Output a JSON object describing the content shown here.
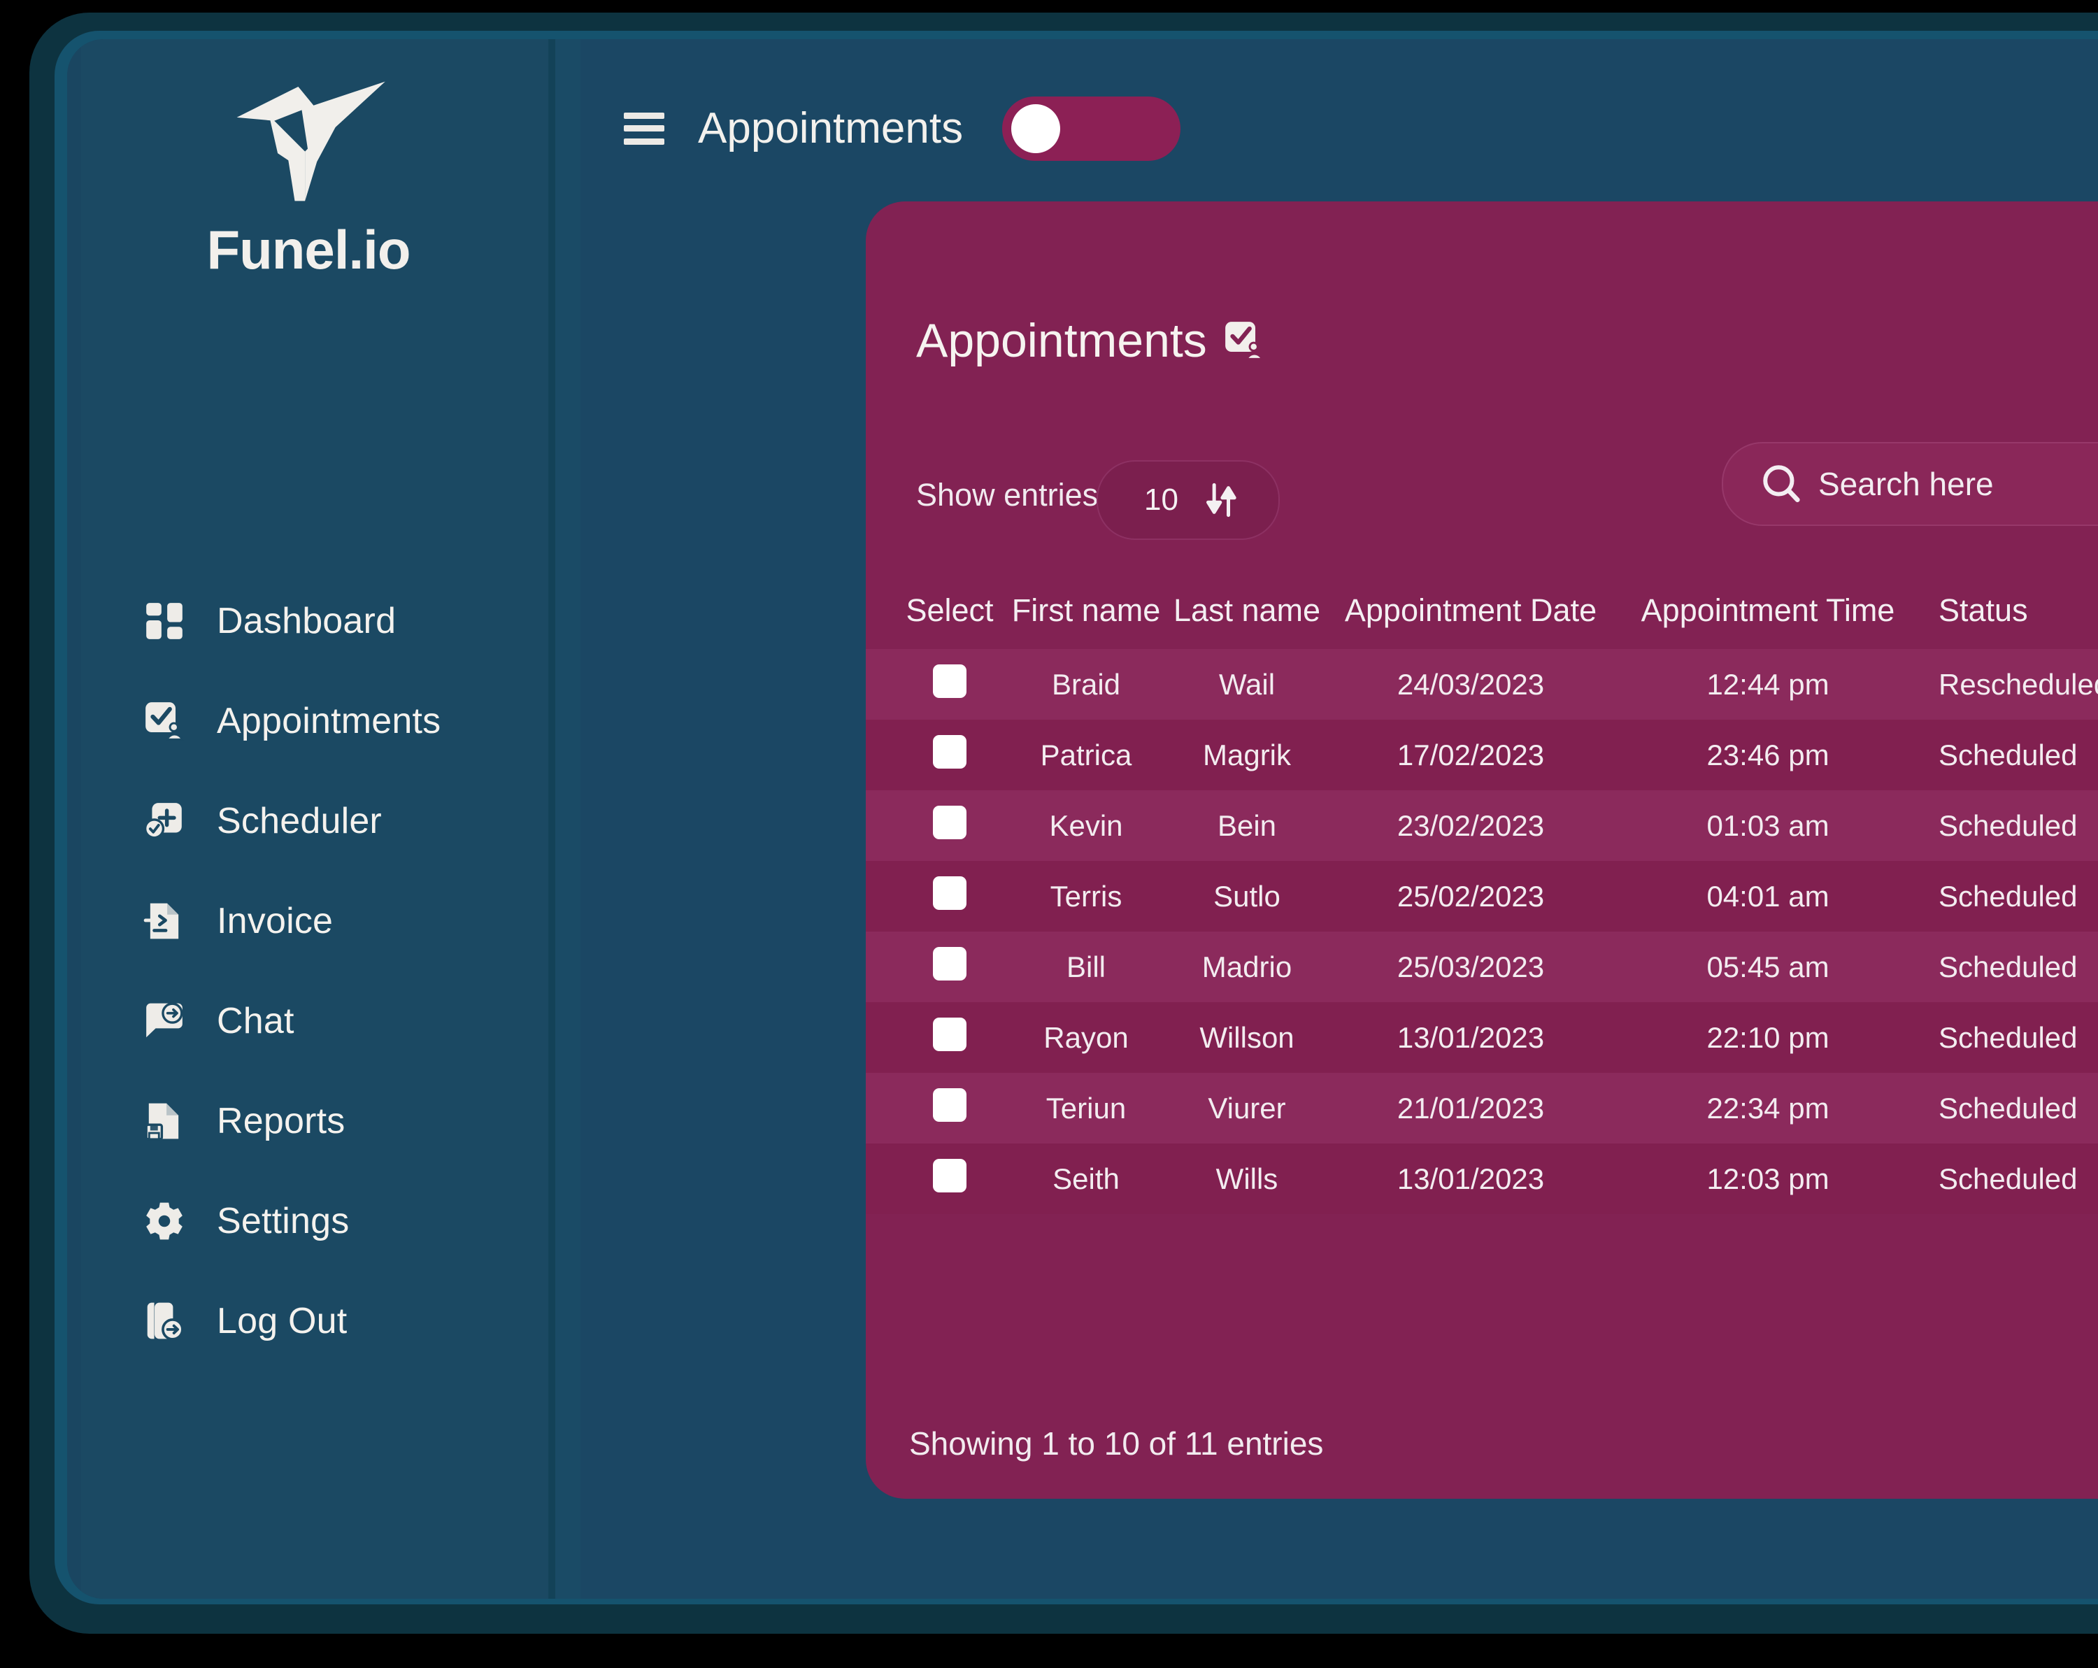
{
  "app": {
    "brand_name": "Funel.io",
    "accent_magenta": "#822253",
    "accent_magenta_light": "#8b2a5c",
    "sidebar_blue": "#1b4963",
    "content_blue": "#1b4764"
  },
  "sidebar": {
    "items": [
      {
        "label": "Dashboard",
        "icon": "grid-icon"
      },
      {
        "label": "Appointments",
        "icon": "clipboard-check-user-icon"
      },
      {
        "label": "Scheduler",
        "icon": "calendar-clock-icon"
      },
      {
        "label": "Invoice",
        "icon": "invoice-document-icon"
      },
      {
        "label": "Chat",
        "icon": "chat-bubble-arrow-icon"
      },
      {
        "label": "Reports",
        "icon": "report-save-icon"
      },
      {
        "label": "Settings",
        "icon": "gear-icon"
      },
      {
        "label": "Log Out",
        "icon": "logout-arrow-icon"
      }
    ]
  },
  "topbar": {
    "menu_icon": "hamburger-icon",
    "title": "Appointments",
    "toggle_state": "off"
  },
  "card": {
    "title": "Appointments",
    "title_icon": "clipboard-check-user-icon",
    "show_entries_label": "Show entries:",
    "entries_value": "10",
    "entries_sort_icon": "sort-updown-icon",
    "search_icon": "search-icon",
    "search_placeholder": "Search here",
    "footer": "Showing 1 to 10 of 11 entries"
  },
  "table": {
    "columns": [
      "Select",
      "First name",
      "Last name",
      "Appointment Date",
      "Appointment Time",
      "Status"
    ],
    "rows": [
      {
        "select": "",
        "first": "Braid",
        "last": "Wail",
        "date": "24/03/2023",
        "time": "12:44 pm",
        "status": "Rescheduled"
      },
      {
        "select": "",
        "first": "Patrica",
        "last": "Magrik",
        "date": "17/02/2023",
        "time": "23:46 pm",
        "status": "Scheduled"
      },
      {
        "select": "",
        "first": "Kevin",
        "last": "Bein",
        "date": "23/02/2023",
        "time": "01:03 am",
        "status": "Scheduled"
      },
      {
        "select": "",
        "first": "Terris",
        "last": "Sutlo",
        "date": "25/02/2023",
        "time": "04:01 am",
        "status": "Scheduled"
      },
      {
        "select": "",
        "first": "Bill",
        "last": "Madrio",
        "date": "25/03/2023",
        "time": "05:45 am",
        "status": "Scheduled"
      },
      {
        "select": "",
        "first": "Rayon",
        "last": "Willson",
        "date": "13/01/2023",
        "time": "22:10 pm",
        "status": "Scheduled"
      },
      {
        "select": "",
        "first": "Teriun",
        "last": "Viurer",
        "date": "21/01/2023",
        "time": "22:34 pm",
        "status": "Scheduled"
      },
      {
        "select": "",
        "first": "Seith",
        "last": "Wills",
        "date": "13/01/2023",
        "time": "12:03 pm",
        "status": "Scheduled"
      }
    ]
  }
}
